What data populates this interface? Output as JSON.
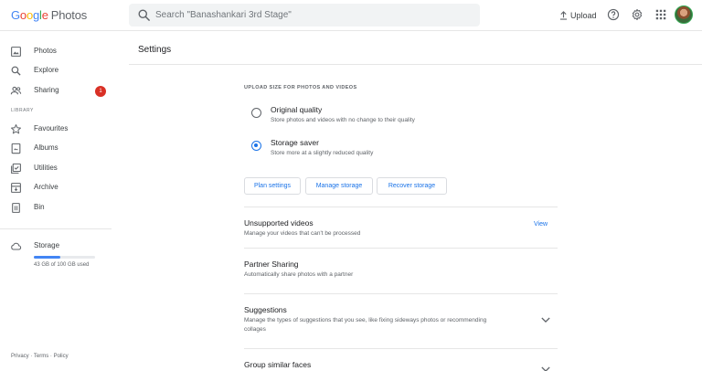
{
  "app": {
    "logo_google": "Google",
    "logo_photos": "Photos"
  },
  "search": {
    "placeholder": "Search \"Banashankari 3rd Stage\""
  },
  "header": {
    "upload_label": "Upload"
  },
  "sidebar": {
    "items": [
      {
        "label": "Photos",
        "icon": "photo-icon"
      },
      {
        "label": "Explore",
        "icon": "search-icon"
      },
      {
        "label": "Sharing",
        "icon": "people-icon",
        "badge": "1"
      }
    ],
    "library_label": "LIBRARY",
    "library_items": [
      {
        "label": "Favourites",
        "icon": "star-icon"
      },
      {
        "label": "Albums",
        "icon": "album-icon"
      },
      {
        "label": "Utilities",
        "icon": "utilities-icon"
      },
      {
        "label": "Archive",
        "icon": "archive-icon"
      },
      {
        "label": "Bin",
        "icon": "trash-icon"
      }
    ],
    "storage": {
      "label": "Storage",
      "usage_text": "43 GB of 100 GB used",
      "used_fraction": 0.43
    },
    "footer": {
      "privacy": "Privacy",
      "terms": "Terms",
      "policy": "Policy"
    }
  },
  "main": {
    "title": "Settings",
    "upload_size": {
      "heading": "UPLOAD SIZE FOR PHOTOS AND VIDEOS",
      "options": [
        {
          "title": "Original quality",
          "subtitle": "Store photos and videos with no change to their quality",
          "selected": false
        },
        {
          "title": "Storage saver",
          "subtitle": "Store more at a slightly reduced quality",
          "selected": true
        }
      ],
      "buttons": {
        "plan": "Plan settings",
        "manage": "Manage storage",
        "recover": "Recover storage"
      }
    },
    "rows": {
      "unsupported": {
        "title": "Unsupported videos",
        "subtitle": "Manage your videos that can't be processed",
        "action": "View"
      },
      "partner": {
        "title": "Partner Sharing",
        "subtitle": "Automatically share photos with a partner"
      },
      "suggestions": {
        "title": "Suggestions",
        "subtitle": "Manage the types of suggestions that you see, like fixing sideways photos or recommending collages"
      },
      "faces": {
        "title": "Group similar faces"
      }
    }
  },
  "colors": {
    "accent": "#1a73e8",
    "badge": "#d93025",
    "storage_fill": "#4285f4"
  }
}
